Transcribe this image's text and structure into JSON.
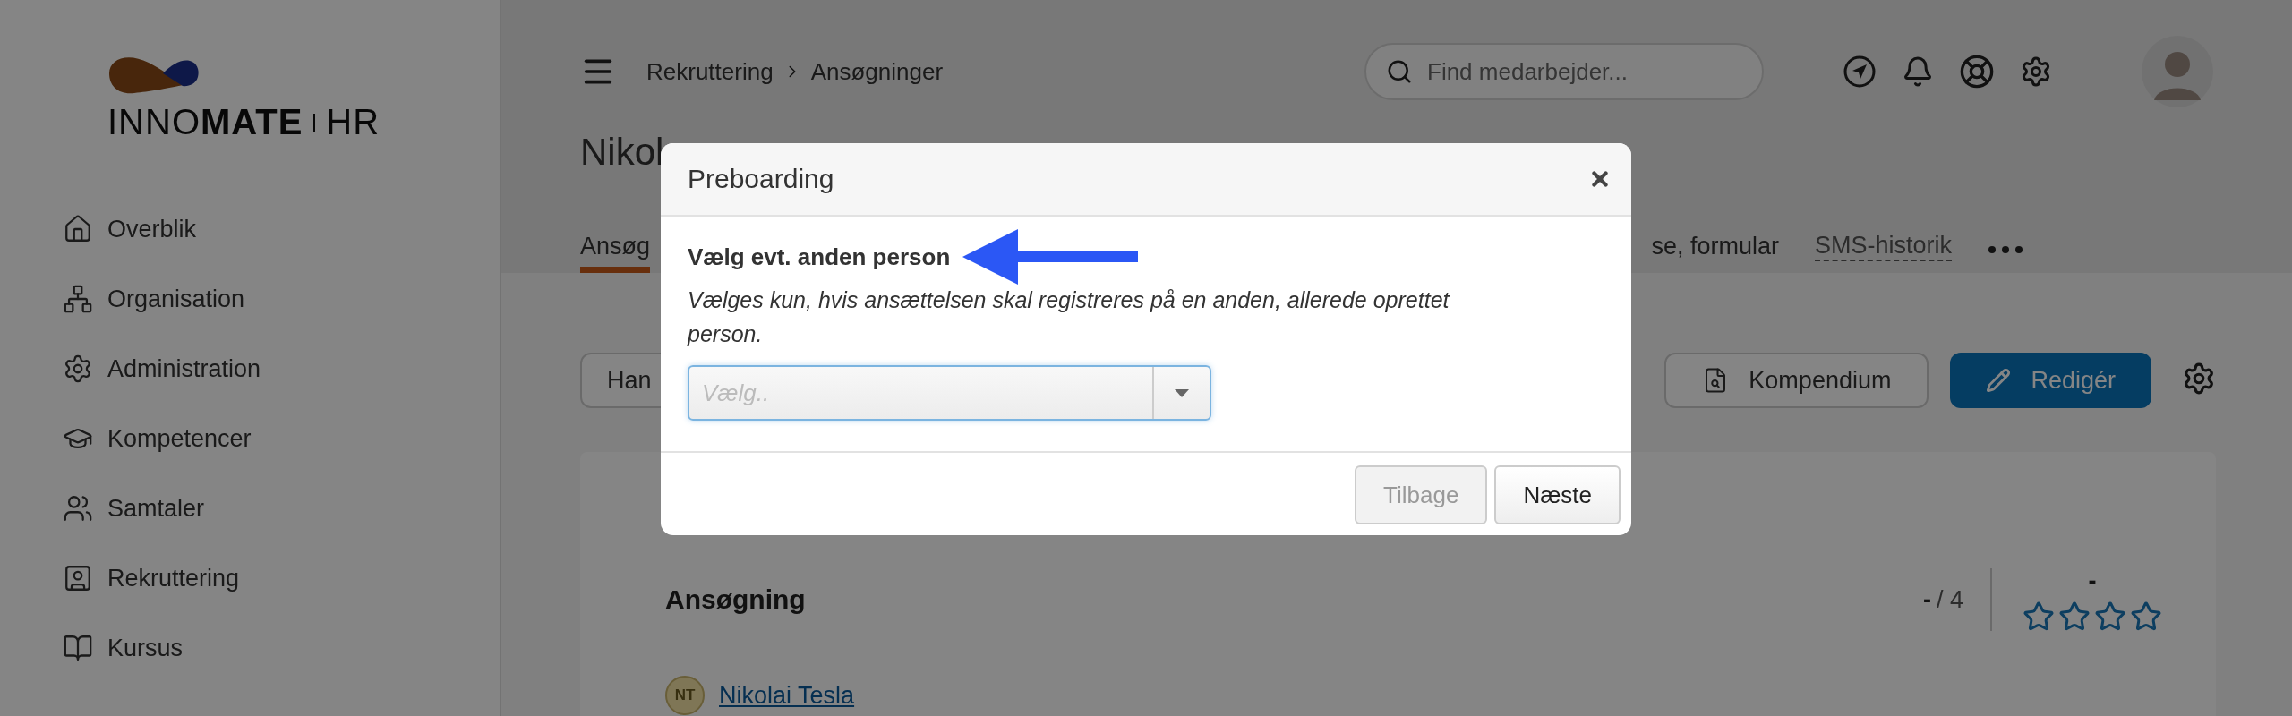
{
  "sidebar": {
    "logo": {
      "text": "INNO**MATE**",
      "suffix": "HR"
    },
    "items": [
      {
        "label": "Overblik"
      },
      {
        "label": "Organisation"
      },
      {
        "label": "Administration"
      },
      {
        "label": "Kompetencer"
      },
      {
        "label": "Samtaler"
      },
      {
        "label": "Rekruttering"
      },
      {
        "label": "Kursus"
      }
    ]
  },
  "header": {
    "breadcrumb": [
      "Rekruttering",
      "Ansøgninger"
    ],
    "search": {
      "placeholder": "Find medarbejder..."
    }
  },
  "page": {
    "title": "Nikol",
    "tabs": [
      {
        "label": "Ansøg",
        "selected": true,
        "kind": "plain"
      },
      {
        "label": "se, formular",
        "selected": false,
        "kind": "plain"
      },
      {
        "label": "SMS-historik",
        "selected": false,
        "kind": "dashed"
      }
    ],
    "left_button": "Han",
    "buttons": [
      {
        "label": "Kompendium",
        "kind": "outline"
      },
      {
        "label": "Redigér",
        "kind": "primary"
      }
    ]
  },
  "card": {
    "title": "Ansøgning",
    "score": {
      "value": "-",
      "total": "/ 4"
    },
    "rating": {
      "value": "-",
      "stars": 0
    },
    "applicant": {
      "initials": "NT",
      "name": "Nikolai Tesla"
    }
  },
  "modal": {
    "title": "Preboarding",
    "label": "Vælg evt. anden person",
    "help": "Vælges kun, hvis ansættelsen skal registreres på en anden, allerede oprettet person.",
    "select": {
      "placeholder": "Vælg.."
    },
    "buttons": [
      {
        "label": "Tilbage",
        "disabled": true
      },
      {
        "label": "Næste",
        "disabled": false
      }
    ]
  }
}
